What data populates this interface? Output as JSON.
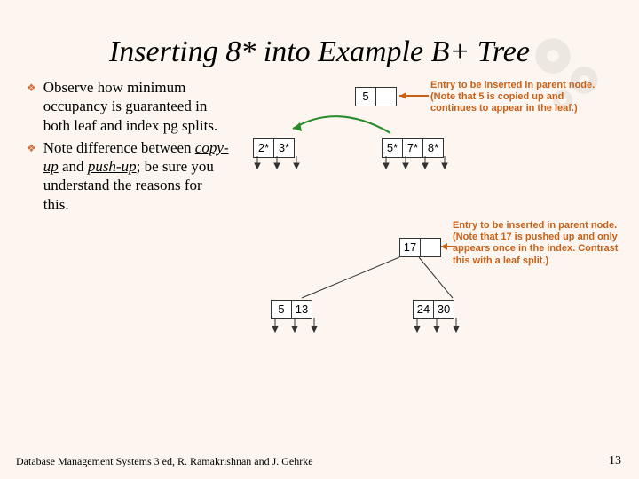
{
  "title": "Inserting 8* into Example B+ Tree",
  "bullets": [
    {
      "text": "Observe how minimum occupancy is guaranteed in both leaf and index pg splits."
    },
    {
      "text_pre": "Note difference between ",
      "em1": "copy-up",
      "mid": " and ",
      "em2": "push-up",
      "text_post": "; be sure you understand the reasons for this."
    }
  ],
  "top_parent": {
    "value": "5"
  },
  "top_leaf": [
    "2*",
    "3*",
    "",
    "",
    "5*",
    "7*",
    "8*"
  ],
  "annot_top": [
    "Entry to be inserted in parent node.",
    "(Note that 5 is copied up and",
    "continues to appear in the leaf.)"
  ],
  "bot_parent": {
    "value": "17"
  },
  "bot_index": [
    "5",
    "13",
    "",
    "",
    "24",
    "30"
  ],
  "annot_bot": [
    "Entry to be inserted in parent node.",
    "(Note that 17 is pushed up and only",
    "appears once in the index. Contrast",
    "this with a leaf split.)"
  ],
  "footer": "Database Management Systems 3 ed,  R. Ramakrishnan and J. Gehrke",
  "pagenum": "13"
}
